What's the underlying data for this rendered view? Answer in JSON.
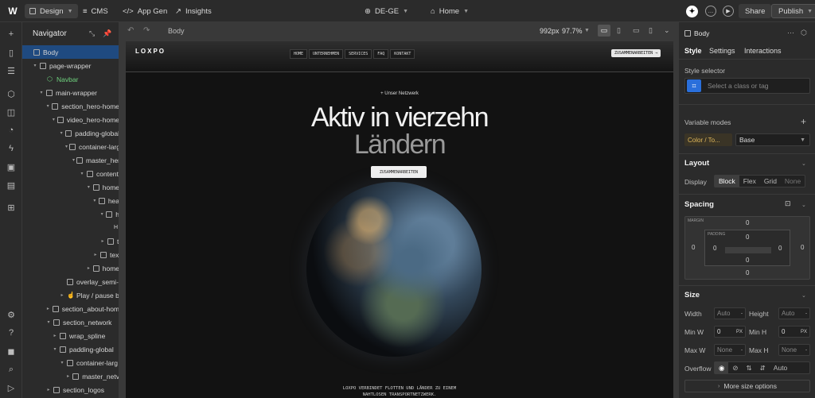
{
  "topbar": {
    "logo": "W",
    "mode": "Design",
    "cms": "CMS",
    "appgen": "App Gen",
    "insights": "Insights",
    "locale": "DE-GE",
    "page": "Home",
    "share": "Share",
    "publish": "Publish",
    "avatar_initial": "✦"
  },
  "navigator": {
    "title": "Navigator",
    "items": [
      {
        "label": "Body"
      },
      {
        "label": "page-wrapper"
      },
      {
        "label": "Navbar"
      },
      {
        "label": "main-wrapper"
      },
      {
        "label": "section_hero-home"
      },
      {
        "label": "video_hero-home"
      },
      {
        "label": "padding-global"
      },
      {
        "label": "container-large"
      },
      {
        "label": "master_hero"
      },
      {
        "label": "content"
      },
      {
        "label": "home"
      },
      {
        "label": "hea"
      },
      {
        "label": "h"
      },
      {
        "label": "H"
      },
      {
        "label": "t"
      },
      {
        "label": "tex"
      },
      {
        "label": "home"
      },
      {
        "label": "overlay_semi-t"
      },
      {
        "label": "Play / pause b"
      },
      {
        "label": "section_about-hom"
      },
      {
        "label": "section_network"
      },
      {
        "label": "wrap_spline"
      },
      {
        "label": "padding-global"
      },
      {
        "label": "container-larg"
      },
      {
        "label": "master_netv"
      },
      {
        "label": "section_logos"
      }
    ]
  },
  "canvas": {
    "breadcrumb": "Body",
    "viewport": "992px",
    "zoom": "97.7%"
  },
  "site": {
    "logo": "LOXPO",
    "nav_links": [
      "HOME",
      "UNTERNEHMEN",
      "SERVICES",
      "FAQ",
      "KONTAKT"
    ],
    "nav_cta": "ZUSAMMENARBEITEN →",
    "eyebrow": "Unser Netzwerk",
    "headline_line1": "Aktiv in vierzehn",
    "headline_line2": "Ländern",
    "hero_button": "ZUSAMMENARBEITEN",
    "tagline_line1": "LOXPO VERBINDET FLOTTEN UND LÄNDER ZU EINEM",
    "tagline_line2": "NAHTLOSEN TRANSPORTNETZWERK."
  },
  "panel": {
    "element": "Body",
    "tabs": [
      "Style",
      "Settings",
      "Interactions"
    ],
    "style_selector_label": "Style selector",
    "selector_placeholder": "Select a class or tag",
    "variable_modes": "Variable modes",
    "mode_chip": "Color / To...",
    "mode_value": "Base",
    "layout_title": "Layout",
    "display_label": "Display",
    "display_options": [
      "Block",
      "Flex",
      "Grid",
      "None"
    ],
    "display_selected": "Block",
    "spacing_title": "Spacing",
    "margin_label": "MARGIN",
    "padding_label": "PADDING",
    "margin": {
      "top": "0",
      "right": "0",
      "bottom": "0",
      "left": "0"
    },
    "padding": {
      "top": "0",
      "right": "0",
      "bottom": "0",
      "left": "0"
    },
    "size_title": "Size",
    "width_label": "Width",
    "width_value": "Auto",
    "height_label": "Height",
    "height_value": "Auto",
    "minw_label": "Min W",
    "minw_value": "0",
    "minh_label": "Min H",
    "minh_value": "0",
    "px_unit": "PX",
    "maxw_label": "Max W",
    "maxw_value": "None",
    "maxh_label": "Max H",
    "maxh_value": "None",
    "overflow_label": "Overflow",
    "overflow_auto": "Auto",
    "more_size": "More size options"
  },
  "colors": {
    "accent": "#2a6fdb",
    "selected_row": "#1f4a80",
    "component_green": "#6fd27e",
    "variable_chip": "#e0b85a"
  }
}
